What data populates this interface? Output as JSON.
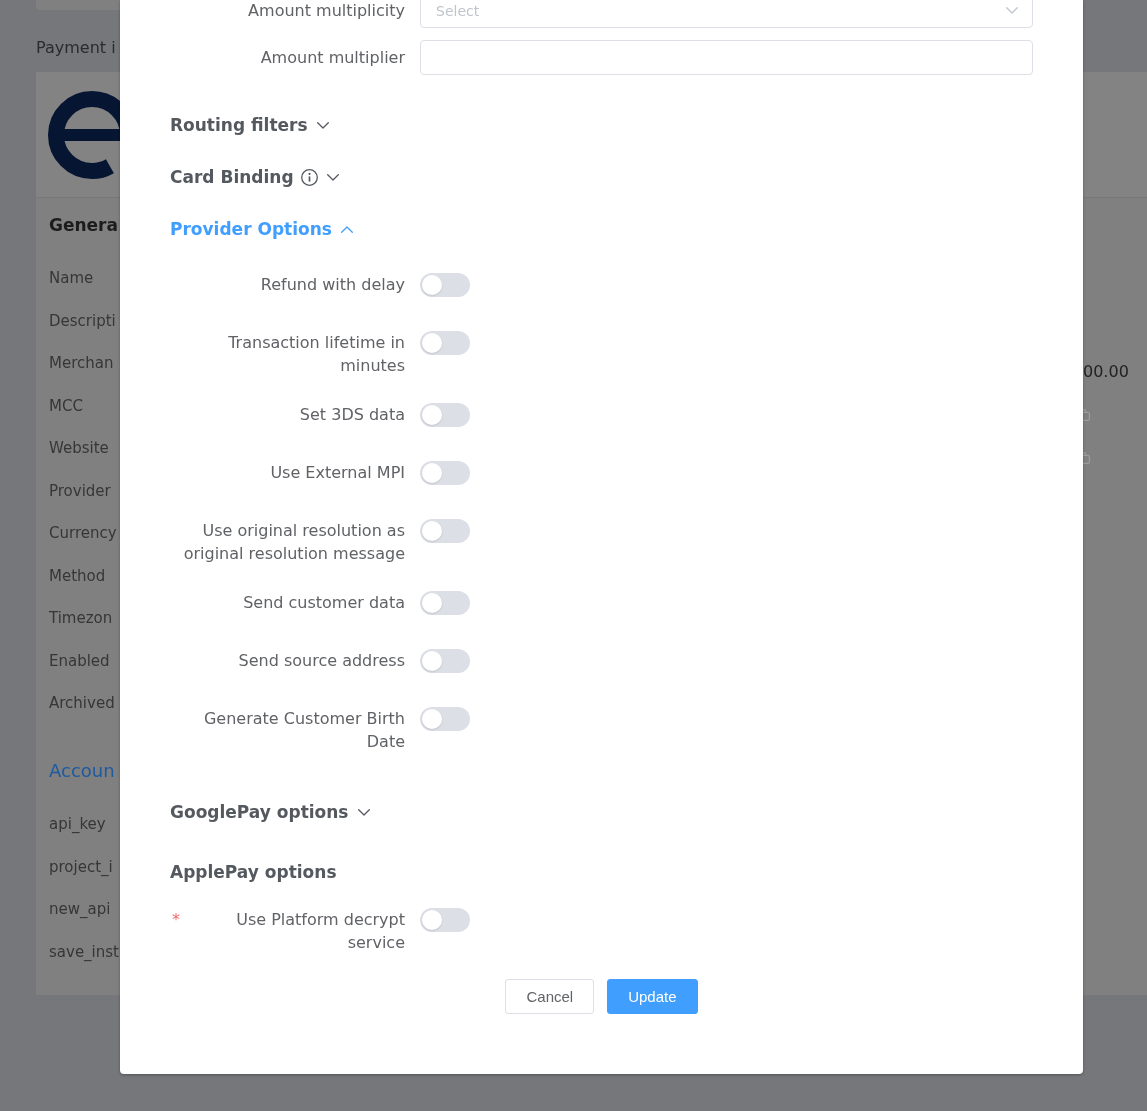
{
  "background": {
    "page_title": "Payment i",
    "general": {
      "title": "Genera",
      "fields": [
        "Name",
        "Descripti",
        "Merchan",
        "MCC",
        "Website",
        "Provider",
        "Currency",
        "Method",
        "Timezon",
        "Enabled",
        "Archived"
      ]
    },
    "accounts": {
      "title": "Accoun",
      "fields": [
        "api_key",
        "project_i",
        "new_api",
        "save_inst"
      ]
    },
    "amount": "00.00"
  },
  "dialog": {
    "fields": [
      {
        "label": "Amount multiplicity",
        "kind": "select",
        "placeholder": "Select"
      },
      {
        "label": "Amount multiplier",
        "kind": "input"
      }
    ],
    "sections": [
      {
        "title": "Routing filters",
        "kind": "collapsible",
        "expanded": false
      },
      {
        "title": "Card Binding",
        "kind": "collapsible",
        "info": true,
        "expanded": false
      },
      {
        "title": "Provider Options",
        "kind": "collapsible",
        "expanded": true,
        "options": [
          {
            "label": "Refund with delay",
            "on": false
          },
          {
            "label": "Transaction lifetime in minutes",
            "on": false
          },
          {
            "label": "Set 3DS data",
            "on": false
          },
          {
            "label": "Use External MPI",
            "on": false
          },
          {
            "label": "Use original resolution as original resolution message",
            "on": false
          },
          {
            "label": "Send customer data",
            "on": false
          },
          {
            "label": "Send source address",
            "on": false
          },
          {
            "label": "Generate Customer Birth Date",
            "on": false
          }
        ]
      },
      {
        "title": "GooglePay options",
        "kind": "collapsible",
        "expanded": false
      },
      {
        "title": "ApplePay options",
        "kind": "static",
        "options": [
          {
            "label": "Use Platform decrypt service",
            "on": false,
            "required_mark": "*"
          }
        ]
      }
    ],
    "buttons": [
      {
        "label": "Cancel",
        "kind": "default"
      },
      {
        "label": "Update",
        "kind": "primary"
      }
    ]
  }
}
